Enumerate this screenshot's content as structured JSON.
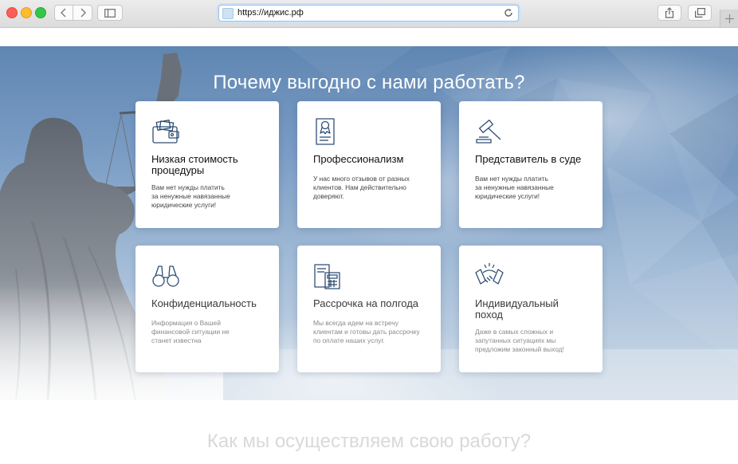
{
  "browser": {
    "url": "https://иджис.рф",
    "icons": {
      "back": "chevron-left-icon",
      "forward": "chevron-right-icon",
      "sidebar": "sidebar-icon",
      "reload": "reload-icon",
      "share": "share-icon",
      "tabs": "tabs-icon",
      "new_tab": "plus-icon"
    }
  },
  "hero": {
    "title": "Почему выгодно с нами работать?",
    "cards": [
      {
        "icon": "wallet-money-icon",
        "title_lines": [
          "Низкая стоимость",
          "процедуры"
        ],
        "desc_lines": [
          "Вам нет нужды платить",
          "за ненужные навязанные",
          "юридические услуги!"
        ]
      },
      {
        "icon": "certificate-document-icon",
        "title_lines": [
          "Профессионализм"
        ],
        "desc_lines": [
          "У нас много отзывов от разных",
          "клиентов. Нам действительно",
          "доверяют."
        ]
      },
      {
        "icon": "gavel-icon",
        "title_lines": [
          "Представитель в суде"
        ],
        "desc_lines": [
          "Вам нет нужды платить",
          "за ненужные навязанные",
          "юридические услуги!"
        ]
      },
      {
        "icon": "binoculars-icon",
        "title_lines": [
          "Конфиденциальность"
        ],
        "desc_lines": [
          "Информация о Вашей",
          "финансовой ситуации не",
          "станет известна"
        ]
      },
      {
        "icon": "calculator-document-icon",
        "title_lines": [
          "Рассрочка на полгода"
        ],
        "desc_lines": [
          "Мы всегда идем на встречу",
          "клиентам и готовы дать рассрочку",
          "по оплате наших услуг."
        ]
      },
      {
        "icon": "handshake-icon",
        "title_lines": [
          "Индивидуальный",
          "поход"
        ],
        "desc_lines": [
          "Даже в самых сложных и",
          "запутанных ситуациях мы",
          "предложим законный выход!"
        ]
      }
    ]
  },
  "next_section": {
    "title": "Как мы осуществляем свою работу?"
  },
  "colors": {
    "icon_blue": "#2f4e75",
    "sky_top": "#5f86b2",
    "sky_bottom": "#cfdbe8",
    "card_bg": "#ffffff"
  }
}
